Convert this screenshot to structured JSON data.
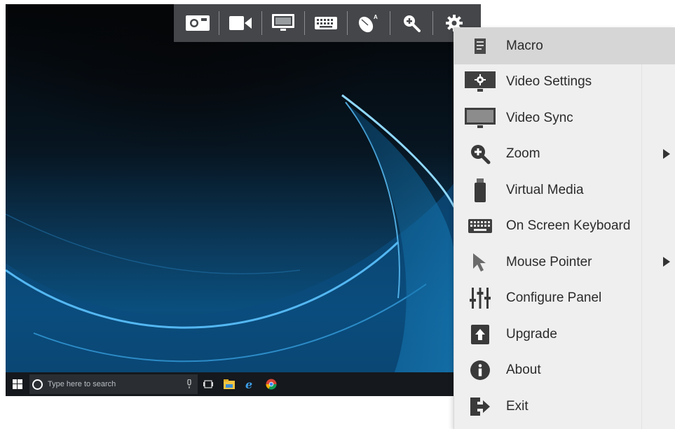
{
  "toolbar": {
    "buttons": [
      {
        "name": "snapshot-icon"
      },
      {
        "name": "video-record-icon"
      },
      {
        "name": "video-settings-icon"
      },
      {
        "name": "keyboard-icon"
      },
      {
        "name": "mouse-icon"
      },
      {
        "name": "zoom-icon"
      },
      {
        "name": "gear-icon"
      }
    ]
  },
  "taskbar": {
    "search_placeholder": "Type here to search"
  },
  "menu": {
    "items": [
      {
        "label": "Macro",
        "icon": "macro-icon",
        "active": true,
        "submenu": false
      },
      {
        "label": "Video Settings",
        "icon": "video-settings-icon",
        "active": false,
        "submenu": false
      },
      {
        "label": "Video Sync",
        "icon": "video-sync-icon",
        "active": false,
        "submenu": false
      },
      {
        "label": "Zoom",
        "icon": "zoom-icon",
        "active": false,
        "submenu": true
      },
      {
        "label": "Virtual Media",
        "icon": "usb-drive-icon",
        "active": false,
        "submenu": false
      },
      {
        "label": "On Screen Keyboard",
        "icon": "keyboard-icon",
        "active": false,
        "submenu": false
      },
      {
        "label": "Mouse Pointer",
        "icon": "cursor-icon",
        "active": false,
        "submenu": true
      },
      {
        "label": "Configure Panel",
        "icon": "sliders-icon",
        "active": false,
        "submenu": false
      },
      {
        "label": "Upgrade",
        "icon": "upgrade-icon",
        "active": false,
        "submenu": false
      },
      {
        "label": "About",
        "icon": "info-icon",
        "active": false,
        "submenu": false
      },
      {
        "label": "Exit",
        "icon": "exit-icon",
        "active": false,
        "submenu": false
      }
    ]
  },
  "colors": {
    "toolbar_bg": "#444649",
    "menu_bg": "#efefef",
    "menu_active": "#d6d6d6",
    "taskbar_bg": "#15181c"
  }
}
